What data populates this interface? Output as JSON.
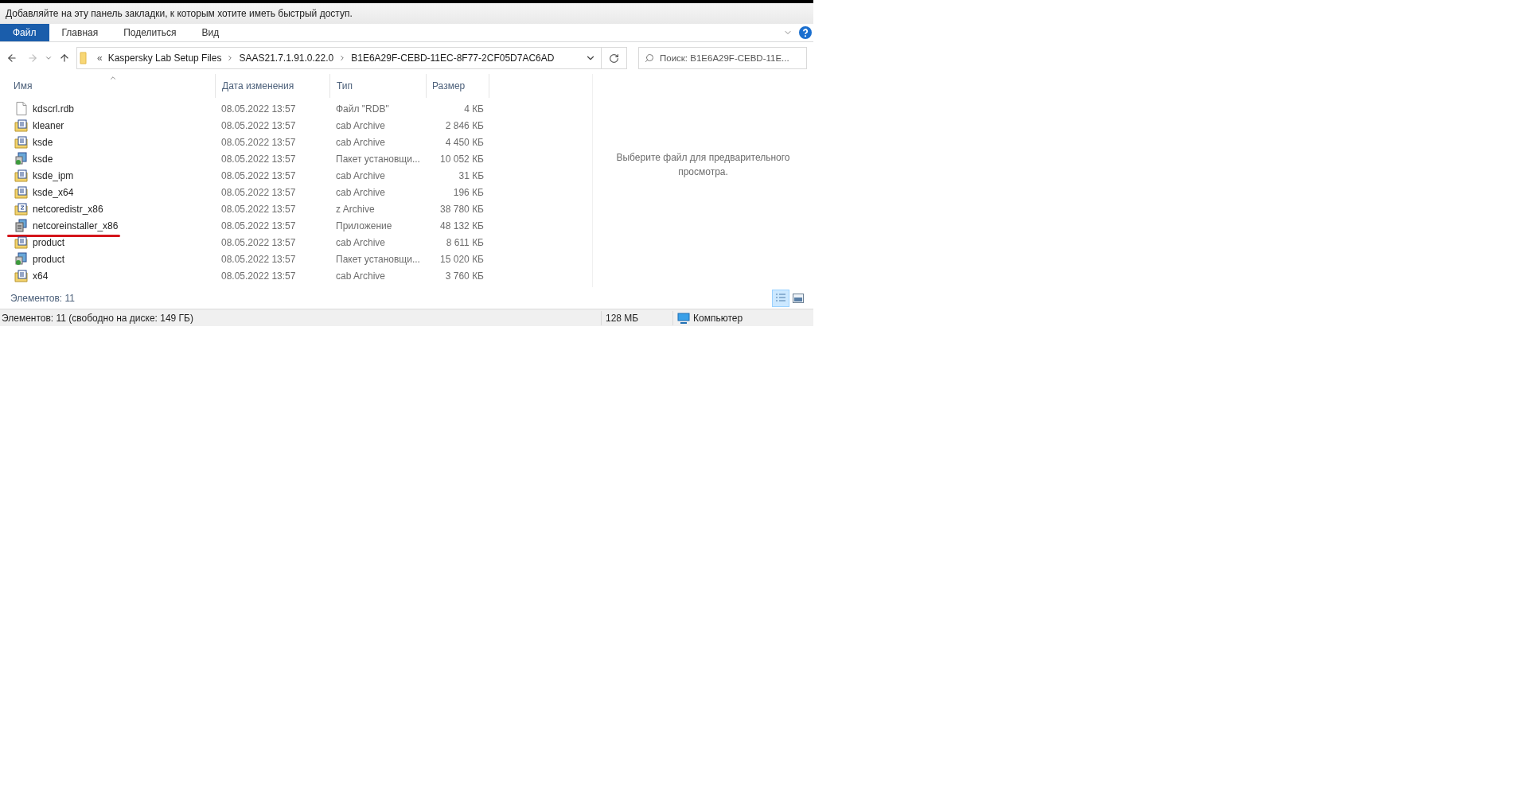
{
  "bookmarks_bar": {
    "text": "Добавляйте на эту панель закладки, к которым хотите иметь быстрый доступ."
  },
  "ribbon_tabs": [
    {
      "label": "Файл",
      "selected": true
    },
    {
      "label": "Главная",
      "selected": false
    },
    {
      "label": "Поделиться",
      "selected": false
    },
    {
      "label": "Вид",
      "selected": false
    }
  ],
  "address": {
    "overflow": "«",
    "crumbs": [
      "Kaspersky Lab Setup Files",
      "SAAS21.7.1.91.0.22.0",
      "B1E6A29F-CEBD-11EC-8F77-2CF05D7AC6AD"
    ]
  },
  "search": {
    "placeholder": "Поиск: B1E6A29F-CEBD-11E..."
  },
  "table": {
    "columns": [
      "Имя",
      "Дата изменения",
      "Тип",
      "Размер"
    ],
    "rows": [
      {
        "kind": "file",
        "name": "kdscrl.rdb",
        "date": "08.05.2022 13:57",
        "type": "Файл \"RDB\"",
        "size": "4 КБ",
        "underlined": false
      },
      {
        "kind": "cab",
        "name": "kleaner",
        "date": "08.05.2022 13:57",
        "type": "cab Archive",
        "size": "2 846 КБ",
        "underlined": false
      },
      {
        "kind": "cab",
        "name": "ksde",
        "date": "08.05.2022 13:57",
        "type": "cab Archive",
        "size": "4 450 КБ",
        "underlined": false
      },
      {
        "kind": "msi",
        "name": "ksde",
        "date": "08.05.2022 13:57",
        "type": "Пакет установщи...",
        "size": "10 052 КБ",
        "underlined": false
      },
      {
        "kind": "cab",
        "name": "ksde_ipm",
        "date": "08.05.2022 13:57",
        "type": "cab Archive",
        "size": "31 КБ",
        "underlined": false
      },
      {
        "kind": "cab",
        "name": "ksde_x64",
        "date": "08.05.2022 13:57",
        "type": "cab Archive",
        "size": "196 КБ",
        "underlined": false
      },
      {
        "kind": "zip",
        "name": "netcoredistr_x86",
        "date": "08.05.2022 13:57",
        "type": "z Archive",
        "size": "38 780 КБ",
        "underlined": false
      },
      {
        "kind": "exe",
        "name": "netcoreinstaller_x86",
        "date": "08.05.2022 13:57",
        "type": "Приложение",
        "size": "48 132 КБ",
        "underlined": true
      },
      {
        "kind": "cab",
        "name": "product",
        "date": "08.05.2022 13:57",
        "type": "cab Archive",
        "size": "8 611 КБ",
        "underlined": false
      },
      {
        "kind": "msi",
        "name": "product",
        "date": "08.05.2022 13:57",
        "type": "Пакет установщи...",
        "size": "15 020 КБ",
        "underlined": false
      },
      {
        "kind": "cab",
        "name": "x64",
        "date": "08.05.2022 13:57",
        "type": "cab Archive",
        "size": "3 760 КБ",
        "underlined": false
      }
    ]
  },
  "preview_text": "Выберите файл для предварительного просмотра.",
  "item_count": "Элементов: 11",
  "view_buttons": [
    {
      "kind": "details",
      "selected": true
    },
    {
      "kind": "preview",
      "selected": false
    }
  ],
  "status_bar": {
    "summary": "Элементов: 11 (свободно на диске: 149 ГБ)",
    "size": "128 МБ",
    "location": "Компьютер"
  }
}
